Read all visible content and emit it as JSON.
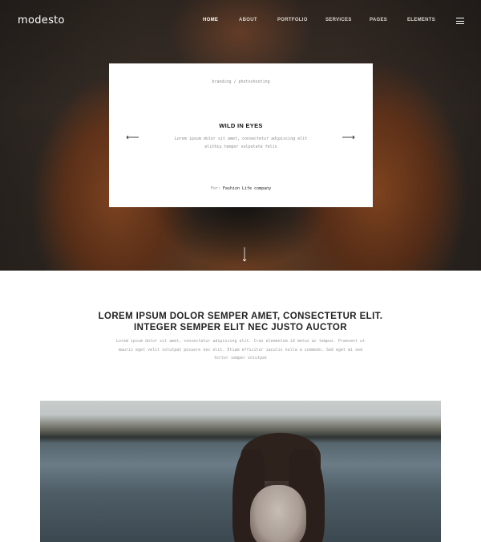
{
  "brand": {
    "logo": "modesto"
  },
  "nav": {
    "items": [
      "HOME",
      "ABOUT",
      "PORTFOLIO",
      "SERVICES",
      "PAGES",
      "ELEMENTS"
    ],
    "active": "HOME",
    "menu_icon": "hamburger-menu-icon"
  },
  "hero_card": {
    "category": "branding / photoshooting",
    "title": "WILD IN EYES",
    "text": "Lorem ipsum dolor sit amet, consectetur adipiscing elit elithiu tempor vulputate felis",
    "for_label": "For:",
    "client": "Fashion Life company",
    "prev_icon": "arrow-left-icon",
    "next_icon": "arrow-right-icon"
  },
  "scroll_icon": "arrow-down-icon",
  "intro": {
    "heading_line1": "LOREM IPSUM DOLOR SEMPER AMET, CONSECTETUR ELIT.",
    "heading_line2": "INTEGER SEMPER ELIT NEC JUSTO AUCTOR",
    "text": "Lorem ipsum dolor sit amet, consectetur adipiscing elit. Cras elementum id metus ac tempus. Praesent ut mauris eget velit volutpat posuere nec elit. Etiam efficitur iaculis nulla a commodo. Sed eget mi sed tortor semper volutpat"
  }
}
